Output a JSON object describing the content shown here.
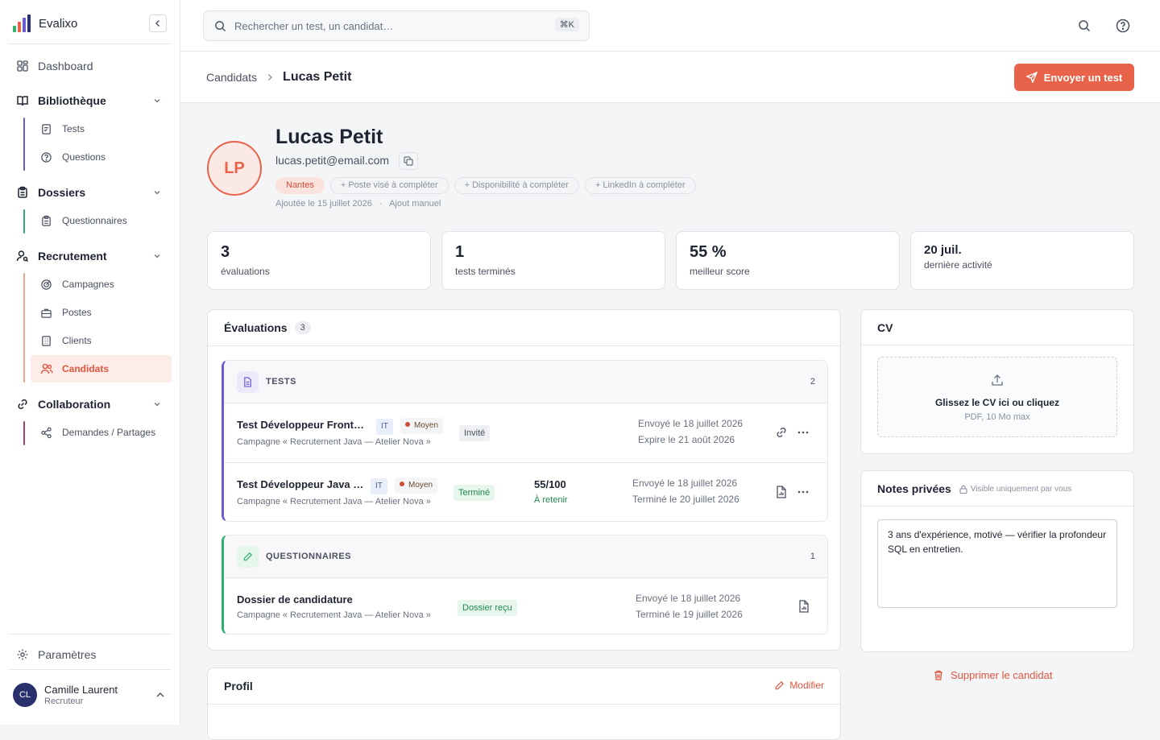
{
  "sidebar": {
    "brand": "Evalixo",
    "dashboard": "Dashboard",
    "library": {
      "label": "Bibliothèque",
      "items": [
        "Tests",
        "Questions"
      ]
    },
    "folders": {
      "label": "Dossiers",
      "items": [
        "Questionnaires"
      ]
    },
    "recruitment": {
      "label": "Recrutement",
      "items": [
        "Campagnes",
        "Postes",
        "Clients",
        "Candidats"
      ]
    },
    "collaboration": {
      "label": "Collaboration",
      "items": [
        "Demandes / Partages"
      ]
    },
    "settings": "Paramètres",
    "user": {
      "initials": "CL",
      "name": "Camille Laurent",
      "role": "Recruteur"
    }
  },
  "search": {
    "placeholder": "Rechercher un test, un candidat…",
    "shortcut": "⌘K"
  },
  "breadcrumb": {
    "parent": "Candidats",
    "current": "Lucas Petit"
  },
  "actions": {
    "send_test": "Envoyer un test"
  },
  "candidate": {
    "initials": "LP",
    "name": "Lucas Petit",
    "email": "lucas.petit@email.com",
    "location": "Nantes",
    "chips": [
      "+ Poste visé à compléter",
      "+ Disponibilité à compléter",
      "+ LinkedIn à compléter"
    ],
    "added": "Ajoutée le 15 juillet 2026",
    "source": "Ajout manuel"
  },
  "stats": [
    {
      "value": "3",
      "label": "évaluations"
    },
    {
      "value": "1",
      "label": "tests terminés"
    },
    {
      "value": "55 %",
      "label": "meilleur score"
    },
    {
      "value": "20 juil.",
      "label": "dernière activité"
    }
  ],
  "evaluations": {
    "title": "Évaluations",
    "count": "3",
    "tests": {
      "label": "TESTS",
      "count": "2",
      "rows": [
        {
          "title": "Test Développeur Front…",
          "campaign": "Campagne « Recrutement Java — Atelier Nova »",
          "domain": "IT",
          "level": "Moyen",
          "status": "Invité",
          "line1": "Envoyé le 18 juillet 2026",
          "line2": "Expire le 21 août 2026"
        },
        {
          "title": "Test Développeur Java …",
          "campaign": "Campagne « Recrutement Java — Atelier Nova »",
          "domain": "IT",
          "level": "Moyen",
          "status": "Terminé",
          "score": "55/100",
          "verdict": "À retenir",
          "line1": "Envoyé le 18 juillet 2026",
          "line2": "Terminé le 20 juillet 2026"
        }
      ]
    },
    "questionnaires": {
      "label": "QUESTIONNAIRES",
      "count": "1",
      "rows": [
        {
          "title": "Dossier de candidature",
          "campaign": "Campagne « Recrutement Java — Atelier Nova »",
          "status": "Dossier reçu",
          "line1": "Envoyé le 18 juillet 2026",
          "line2": "Terminé le 19 juillet 2026"
        }
      ]
    }
  },
  "cv": {
    "title": "CV",
    "drop": "Glissez le CV ici ou cliquez",
    "hint": "PDF, 10 Mo max"
  },
  "notes": {
    "title": "Notes privées",
    "visibility": "Visible uniquement par vous",
    "text": "3 ans d'expérience, motivé — vérifier la profondeur SQL en entretien."
  },
  "delete": "Supprimer le candidat",
  "profile": {
    "title": "Profil",
    "edit": "Modifier"
  },
  "colors": {
    "accent": "#e8634a",
    "tests": "#6b5bd2",
    "questionnaires": "#2fae6e"
  }
}
